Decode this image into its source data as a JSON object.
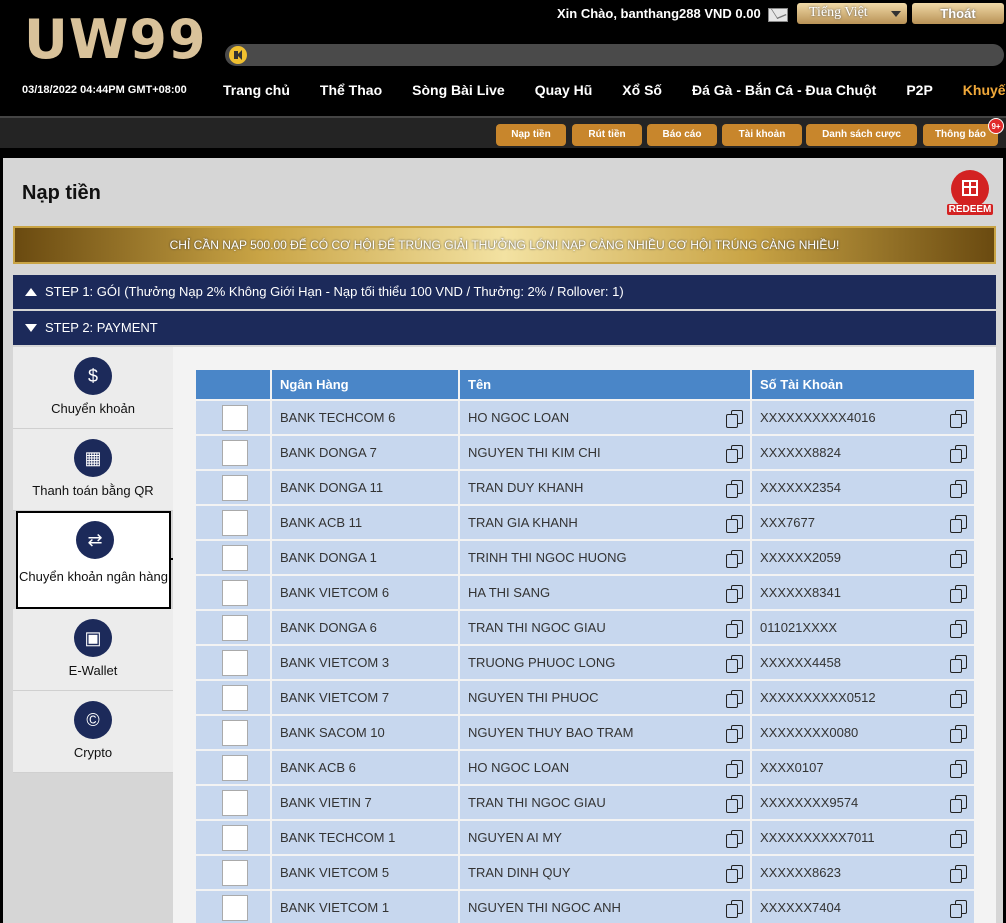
{
  "header": {
    "logo": "UW99",
    "greeting": "Xin Chào, banthang288 VND 0.00",
    "language": "Tiếng Việt",
    "logout": "Thoát",
    "datetime": "03/18/2022 04:44PM GMT+08:00",
    "nav": [
      "Trang chủ",
      "Thể Thao",
      "Sòng Bài Live",
      "Quay Hũ",
      "Xổ Số",
      "Đá Gà - Bắn Cá - Đua Chuột",
      "P2P",
      "Khuyến mại"
    ]
  },
  "toolbar": {
    "buttons": [
      "Nạp tiền",
      "Rút tiền",
      "Báo cáo",
      "Tài khoản",
      "Danh sách cược",
      "Thông báo"
    ],
    "notification_badge": "9+"
  },
  "page": {
    "title": "Nạp tiền",
    "redeem_label": "REDEEM",
    "promo_text": "CHỈ CẦN NẠP 500.00 ĐỂ CÓ CƠ HỘI ĐỂ TRÚNG GIẢI THƯỞNG LỚN! NẠP CÀNG NHIỀU CƠ HỘI TRÚNG CÀNG NHIỀU!",
    "step1": "STEP 1: GÓI (Thưởng Nạp 2% Không Giới Hạn - Nạp tối thiểu 100 VND / Thưởng: 2% / Rollover: 1)",
    "step2": "STEP 2: PAYMENT"
  },
  "sidebar": {
    "items": [
      {
        "label": "Chuyển khoản",
        "icon": "bank-transfer-icon"
      },
      {
        "label": "Thanh toán bằng QR",
        "icon": "qr-code-icon"
      },
      {
        "label": "Chuyển khoản ngân hàng",
        "icon": "bank-exchange-icon"
      },
      {
        "label": "E-Wallet",
        "icon": "wallet-icon"
      },
      {
        "label": "Crypto",
        "icon": "crypto-icon"
      }
    ]
  },
  "table": {
    "headers": [
      "",
      "Ngân Hàng",
      "Tên",
      "Số Tài Khoản"
    ],
    "rows": [
      {
        "bank": "BANK TECHCOM 6",
        "name": "HO NGOC LOAN",
        "account": "XXXXXXXXXX4016"
      },
      {
        "bank": "BANK DONGA 7",
        "name": "NGUYEN THI KIM CHI",
        "account": "XXXXXX8824"
      },
      {
        "bank": "BANK DONGA 11",
        "name": "TRAN DUY KHANH",
        "account": "XXXXXX2354"
      },
      {
        "bank": "BANK ACB 11",
        "name": "TRAN GIA KHANH",
        "account": "XXX7677"
      },
      {
        "bank": "BANK DONGA 1",
        "name": "TRINH THI NGOC HUONG",
        "account": "XXXXXX2059"
      },
      {
        "bank": "BANK VIETCOM 6",
        "name": "HA THI SANG",
        "account": "XXXXXX8341"
      },
      {
        "bank": "BANK DONGA 6",
        "name": "TRAN THI NGOC GIAU",
        "account": "011021XXXX"
      },
      {
        "bank": "BANK VIETCOM 3",
        "name": "TRUONG PHUOC LONG",
        "account": "XXXXXX4458"
      },
      {
        "bank": "BANK VIETCOM 7",
        "name": "NGUYEN THI PHUOC",
        "account": "XXXXXXXXXX0512"
      },
      {
        "bank": "BANK SACOM 10",
        "name": "NGUYEN THUY BAO TRAM",
        "account": "XXXXXXXX0080"
      },
      {
        "bank": "BANK ACB 6",
        "name": "HO NGOC LOAN",
        "account": "XXXX0107"
      },
      {
        "bank": "BANK VIETIN 7",
        "name": "TRAN THI NGOC GIAU",
        "account": "XXXXXXXX9574"
      },
      {
        "bank": "BANK TECHCOM 1",
        "name": "NGUYEN AI MY",
        "account": "XXXXXXXXXX7011"
      },
      {
        "bank": "BANK VIETCOM 5",
        "name": "TRAN DINH QUY",
        "account": "XXXXXX8623"
      },
      {
        "bank": "BANK VIETCOM 1",
        "name": "NGUYEN THI NGOC ANH",
        "account": "XXXXXX7404"
      }
    ]
  }
}
